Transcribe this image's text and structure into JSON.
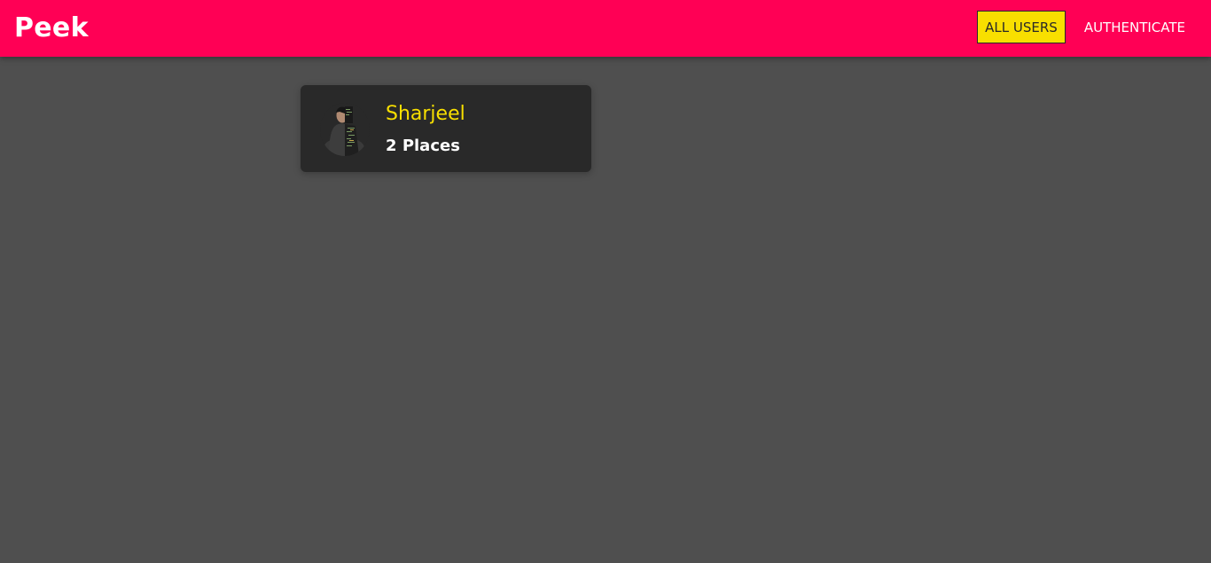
{
  "header": {
    "brand": "Peek",
    "nav": {
      "all_users": "ALL USERS",
      "authenticate": "AUTHENTICATE"
    }
  },
  "users": [
    {
      "name": "Sharjeel",
      "places_count": "2",
      "places_label": "Places",
      "avatar_icon": "user-avatar-image"
    }
  ],
  "colors": {
    "header_bg": "#ff0055",
    "page_bg": "#4f4f4f",
    "card_bg": "#292929",
    "accent": "#f8df00",
    "text_light": "#ffffff"
  }
}
